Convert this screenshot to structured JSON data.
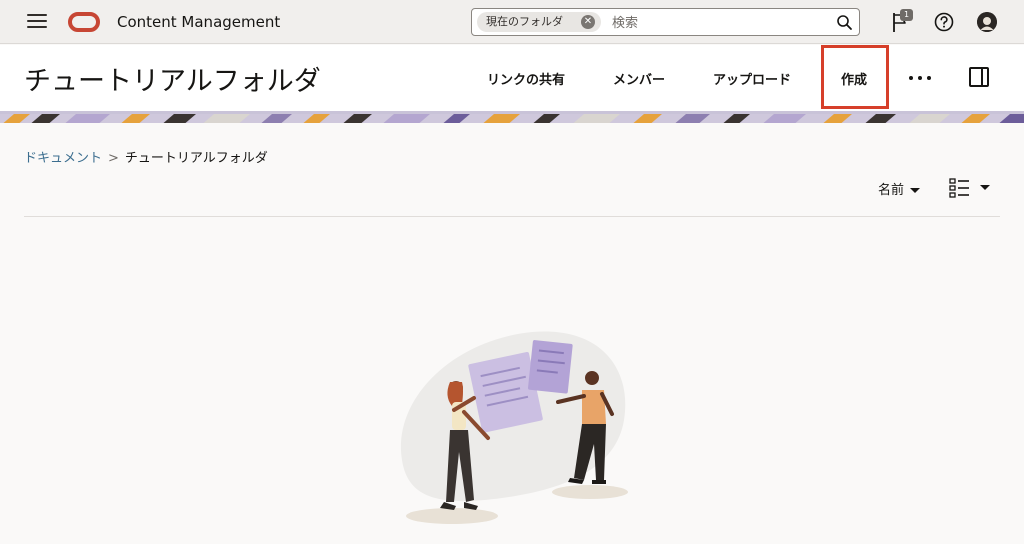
{
  "topbar": {
    "app_title": "Content Management",
    "search": {
      "scope_chip": "現在のフォルダ",
      "placeholder": "検索"
    },
    "notifications_count": "1"
  },
  "header": {
    "title": "チュートリアルフォルダ",
    "actions": {
      "share_link": "リンクの共有",
      "members": "メンバー",
      "upload": "アップロード",
      "create": "作成"
    }
  },
  "breadcrumb": {
    "root": "ドキュメント",
    "separator": ">",
    "current": "チュートリアルフォルダ"
  },
  "toolbar": {
    "sort_label": "名前"
  },
  "colors": {
    "brand_red": "#c74634",
    "highlight": "#d63f2a",
    "link": "#3c6e8f",
    "banner_purple": "#b4a6d0",
    "banner_orange": "#e6a23c"
  },
  "icons": {
    "menu": "hamburger-menu-icon",
    "search": "search-icon",
    "notifications": "flag-icon",
    "help": "help-icon",
    "more": "more-options-icon",
    "panel": "side-panel-icon",
    "view": "list-view-icon"
  }
}
